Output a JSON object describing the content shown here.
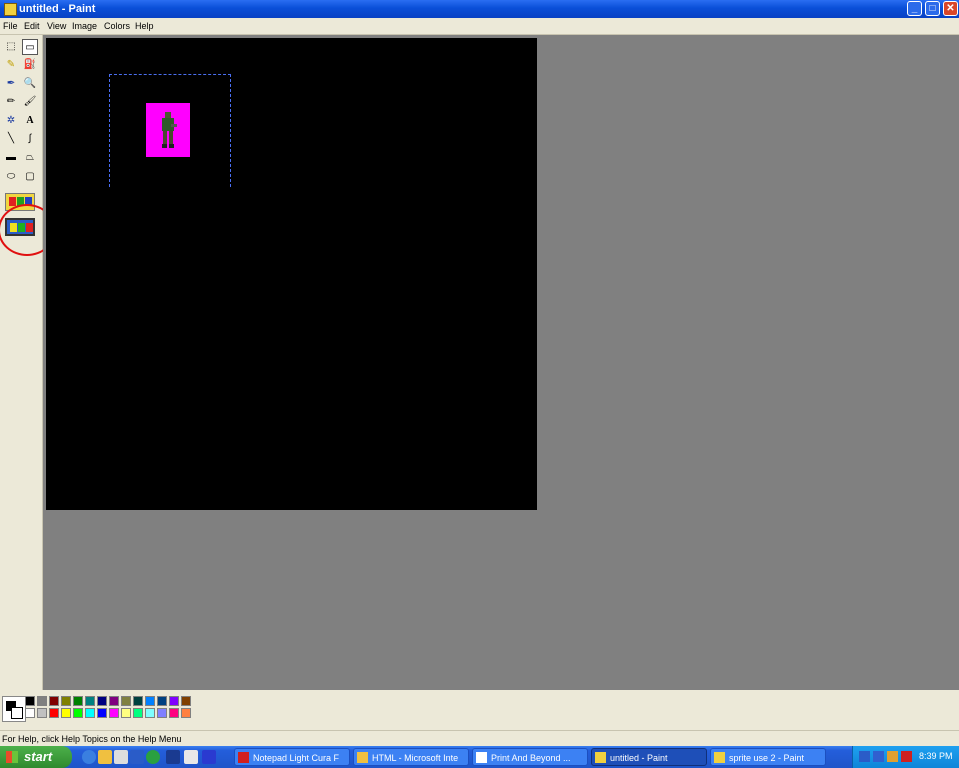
{
  "window": {
    "title": "untitled - Paint",
    "minimize_glyph": "_",
    "maximize_glyph": "□",
    "close_glyph": "✕"
  },
  "menu": {
    "items": [
      "File",
      "Edit",
      "View",
      "Image",
      "Colors",
      "Help"
    ]
  },
  "toolbox": {
    "tools": [
      {
        "name": "free-form-select-icon",
        "glyph": "⬚"
      },
      {
        "name": "select-icon",
        "glyph": "▭"
      },
      {
        "name": "eraser-icon",
        "glyph": "✎"
      },
      {
        "name": "fill-with-color-icon",
        "glyph": "⛽"
      },
      {
        "name": "pick-color-icon",
        "glyph": "✒"
      },
      {
        "name": "magnifier-icon",
        "glyph": "🔍"
      },
      {
        "name": "pencil-icon",
        "glyph": "✏"
      },
      {
        "name": "brush-icon",
        "glyph": "🖌"
      },
      {
        "name": "airbrush-icon",
        "glyph": "✲"
      },
      {
        "name": "text-icon",
        "glyph": "A"
      },
      {
        "name": "line-icon",
        "glyph": "╲"
      },
      {
        "name": "curve-icon",
        "glyph": "∫"
      },
      {
        "name": "rectangle-icon",
        "glyph": "▬"
      },
      {
        "name": "polygon-icon",
        "glyph": "⏢"
      },
      {
        "name": "ellipse-icon",
        "glyph": "⬭"
      },
      {
        "name": "rounded-rectangle-icon",
        "glyph": "▢"
      }
    ],
    "annotation_color": "#e01010"
  },
  "palette": {
    "top_row": [
      "#000000",
      "#808080",
      "#800000",
      "#808000",
      "#008000",
      "#008080",
      "#000080",
      "#800080",
      "#808040",
      "#004040",
      "#0080ff",
      "#004080",
      "#8000ff",
      "#804000"
    ],
    "bottom_row": [
      "#ffffff",
      "#c0c0c0",
      "#ff0000",
      "#ffff00",
      "#00ff00",
      "#00ffff",
      "#0000ff",
      "#ff00ff",
      "#ffff80",
      "#00ff80",
      "#80ffff",
      "#8080ff",
      "#ff0080",
      "#ff8040"
    ]
  },
  "status": {
    "help_text": "For Help, click Help Topics on the Help Menu"
  },
  "taskbar": {
    "start_label": "start",
    "tasks": [
      {
        "label": "Notepad Light Cura F",
        "icon_color": "#d02020"
      },
      {
        "label": "HTML - Microsoft Inte",
        "icon_color": "#f0c040"
      },
      {
        "label": "Print And Beyond ...",
        "icon_color": "#ffffff"
      },
      {
        "label": "untitled - Paint",
        "icon_color": "#f0d040",
        "active": true
      },
      {
        "label": "sprite use 2 - Paint",
        "icon_color": "#f0d040"
      }
    ],
    "clock": "8:39 PM"
  }
}
